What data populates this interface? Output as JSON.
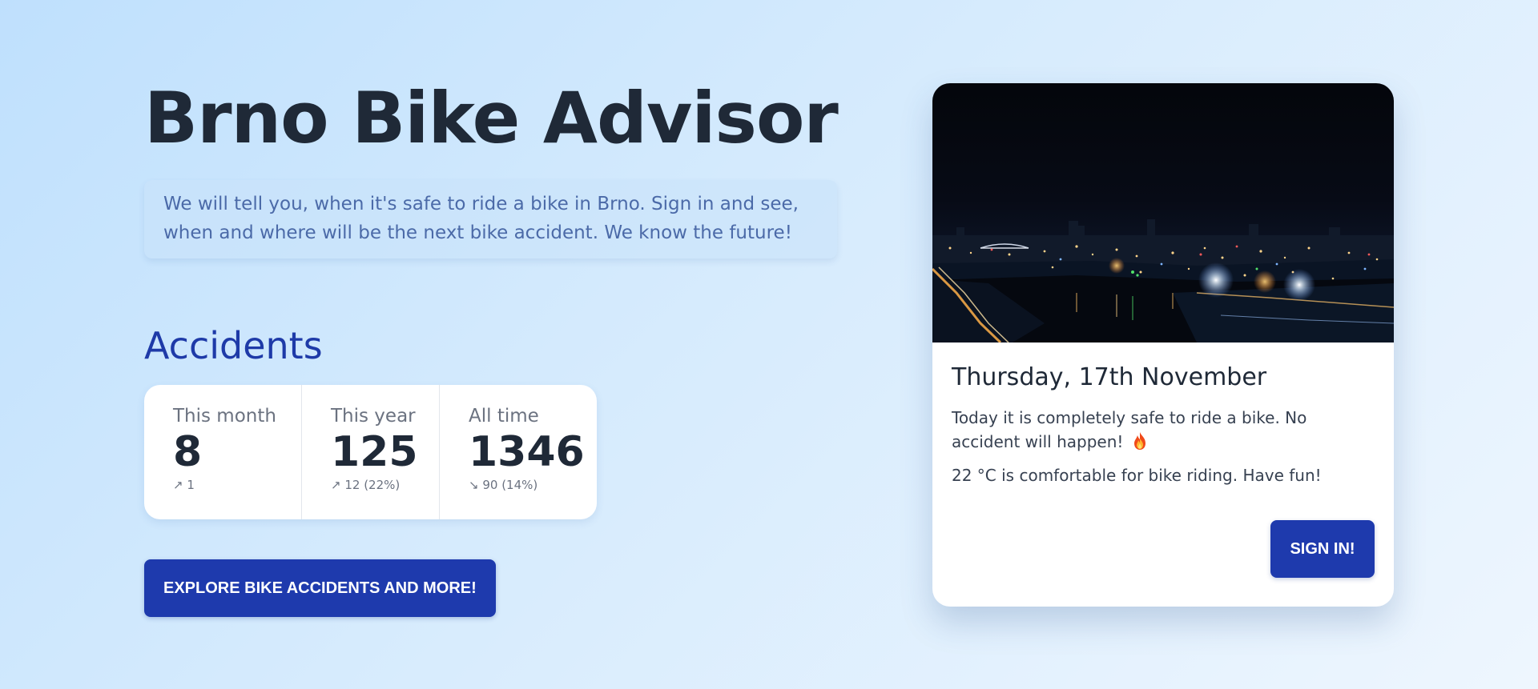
{
  "hero": {
    "title": "Brno Bike Advisor",
    "description": "We will tell you, when it's safe to ride a bike in Brno. Sign in and see, when and where will be the next bike accident. We know the future!"
  },
  "accidents": {
    "title": "Accidents",
    "stats": [
      {
        "label": "This month",
        "value": "8",
        "diff": "↗ 1"
      },
      {
        "label": "This year",
        "value": "125",
        "diff": "↗ 12 (22%)"
      },
      {
        "label": "All time",
        "value": "1346",
        "diff": "↘ 90 (14%)"
      }
    ]
  },
  "explore_button": "EXPLORE BIKE ACCIDENTS AND MORE!",
  "card": {
    "image_icon": "night-city-photo",
    "date": "Thursday, 17th November",
    "forecast": "Today it is completely safe to ride a bike. No accident will happen!",
    "forecast_icon": "fire-icon",
    "weather": "22 °C is comfortable for bike riding. Have fun!",
    "signin_button": "SIGN IN!"
  },
  "colors": {
    "accent": "#1e3aad",
    "title": "#1f2937",
    "section_title": "#1e3aa8",
    "description": "#4b6aa8"
  }
}
